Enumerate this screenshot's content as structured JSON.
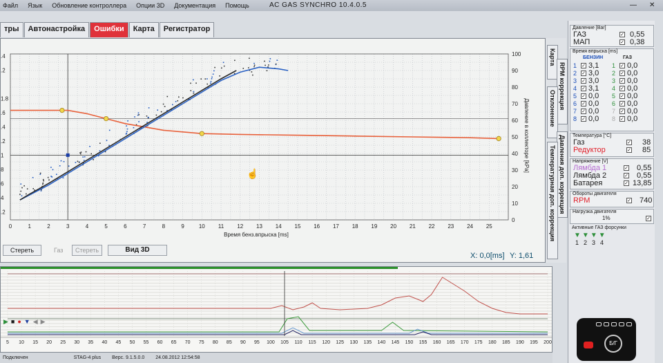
{
  "window": {
    "title": "AC GAS SYNCHRO  10.4.0.5",
    "min": "—",
    "close": "✕"
  },
  "menu": [
    "Файл",
    "Язык",
    "Обновление контроллера",
    "Опции 3D",
    "Документация",
    "Помощь"
  ],
  "tabs": [
    {
      "label": "тры",
      "active": false
    },
    {
      "label": "Автонастройка",
      "active": false
    },
    {
      "label": "Ошибки",
      "active": true
    },
    {
      "label": "Карта",
      "active": false
    },
    {
      "label": "Регистратор",
      "active": false
    }
  ],
  "side_tabs": [
    "Карта",
    "RPM коррекция",
    "Отклонение",
    "Давления доп. коррекция",
    "Температурная доп. коррекция"
  ],
  "chart_data": {
    "type": "scatter",
    "xlabel": "Время бенз.впрыска [ms]",
    "y2label": "Давление в коллекторе [kPa]",
    "x_ticks": [
      0,
      1,
      2,
      3,
      4,
      5,
      6,
      7,
      8,
      9,
      10,
      11,
      12,
      13,
      14,
      15,
      16,
      17,
      18,
      19,
      20,
      21,
      22,
      23,
      24,
      25
    ],
    "y_left_ticks": [
      ".4",
      ".2",
      "",
      "1.8",
      ".6",
      ".4",
      ".2",
      "1",
      "8",
      "6",
      "4",
      ".2"
    ],
    "y_right_ticks": [
      100,
      90,
      80,
      70,
      60,
      50,
      40,
      30,
      20,
      10,
      0
    ],
    "xlim": [
      0,
      26
    ],
    "y2lim": [
      0,
      100
    ],
    "series": [
      {
        "color": "#e8603a",
        "points": [
          [
            0,
            66
          ],
          [
            1,
            66
          ],
          [
            2,
            66
          ],
          [
            3,
            66
          ],
          [
            4,
            64
          ],
          [
            5,
            61
          ],
          [
            6,
            58
          ],
          [
            7,
            56
          ],
          [
            8,
            54
          ],
          [
            9,
            53
          ],
          [
            10,
            52
          ],
          [
            12,
            51.5
          ],
          [
            15,
            51
          ],
          [
            18,
            50.5
          ],
          [
            21,
            50
          ],
          [
            24,
            49.5
          ],
          [
            25.5,
            49
          ]
        ]
      },
      {
        "color": "#2b62c4",
        "points": [
          [
            0.5,
            12
          ],
          [
            1,
            15
          ],
          [
            2,
            21
          ],
          [
            3,
            28
          ],
          [
            4,
            35
          ],
          [
            5,
            42
          ],
          [
            6,
            49
          ],
          [
            7,
            56
          ],
          [
            8,
            63
          ],
          [
            9,
            70
          ],
          [
            10,
            77
          ],
          [
            11,
            84
          ],
          [
            12,
            89
          ],
          [
            13,
            92
          ],
          [
            14,
            91
          ],
          [
            14.5,
            90
          ]
        ]
      },
      {
        "color": "#2a2a2a",
        "points": [
          [
            0.5,
            12
          ],
          [
            1,
            15.5
          ],
          [
            2,
            22
          ],
          [
            3,
            29
          ],
          [
            4,
            36
          ],
          [
            5,
            43
          ],
          [
            6,
            50
          ],
          [
            7,
            57
          ],
          [
            8,
            64
          ],
          [
            9,
            71
          ],
          [
            10,
            78
          ],
          [
            11,
            85
          ],
          [
            11.8,
            90
          ]
        ]
      }
    ],
    "markers": [
      [
        2.7,
        66
      ],
      [
        5,
        61
      ],
      [
        10,
        52
      ],
      [
        25.5,
        49
      ]
    ],
    "readout": {
      "x": "X:  0,0[ms]",
      "y": "Y: 1,61"
    }
  },
  "bottom_controls": {
    "clear1": "Стереть",
    "gas": "Газ",
    "clear2": "Стереть",
    "view3d": "Вид 3D"
  },
  "panel": {
    "pressure": {
      "title": "Давление [Bar]",
      "rows": [
        {
          "label": "ГАЗ",
          "value": "0,55"
        },
        {
          "label": "МАП",
          "value": "0,38"
        }
      ]
    },
    "inj": {
      "title": "Время впрыска [ms]",
      "col_petrol": "БЕНЗИН",
      "col_gas": "ГАЗ",
      "rows": [
        {
          "n": "1",
          "petrol": "3,1",
          "gas": "0,0"
        },
        {
          "n": "2",
          "petrol": "3,0",
          "gas": "0,0"
        },
        {
          "n": "3",
          "petrol": "3,0",
          "gas": "0,0"
        },
        {
          "n": "4",
          "petrol": "3,1",
          "gas": "0,0"
        },
        {
          "n": "5",
          "petrol": "0,0",
          "gas": "0,0"
        },
        {
          "n": "6",
          "petrol": "0,0",
          "gas": "0,0"
        },
        {
          "n": "7",
          "petrol": "0,0",
          "gas": "0,0"
        },
        {
          "n": "8",
          "petrol": "0,0",
          "gas": "0,0"
        }
      ]
    },
    "temp": {
      "title": "Температура [°C]",
      "rows": [
        {
          "label": "Газ",
          "value": "38"
        },
        {
          "label": "Редуктор",
          "value": "85"
        }
      ]
    },
    "volt": {
      "title": "Напряжение [V]",
      "rows": [
        {
          "label": "Лямбда 1",
          "value": "0,55"
        },
        {
          "label": "Лямбда 2",
          "value": "0,55"
        },
        {
          "label": "Батарея",
          "value": "13,85"
        }
      ]
    },
    "rpm": {
      "title": "Обороты двигателя",
      "label": "RPM",
      "value": "740"
    },
    "load": {
      "title": "Нагрузка двигателя",
      "value": "1%"
    },
    "injectors": {
      "title": "Активные  ГАЗ форсунки",
      "labels": [
        "1",
        "2",
        "3",
        "4"
      ]
    }
  },
  "logger": {
    "x_ticks": [
      5,
      10,
      15,
      20,
      25,
      30,
      35,
      40,
      45,
      50,
      55,
      60,
      65,
      70,
      75,
      80,
      85,
      90,
      95,
      100,
      105,
      110,
      115,
      120,
      125,
      130,
      135,
      140,
      145,
      150,
      155,
      160,
      165,
      170,
      175,
      180,
      185,
      190,
      195,
      200
    ]
  },
  "status": [
    "Подключен",
    "STAG-4 plus",
    "Верс. 9.1.5.0.0",
    "24.08.2012 12:54:58"
  ],
  "switch_label": "Б/Г"
}
